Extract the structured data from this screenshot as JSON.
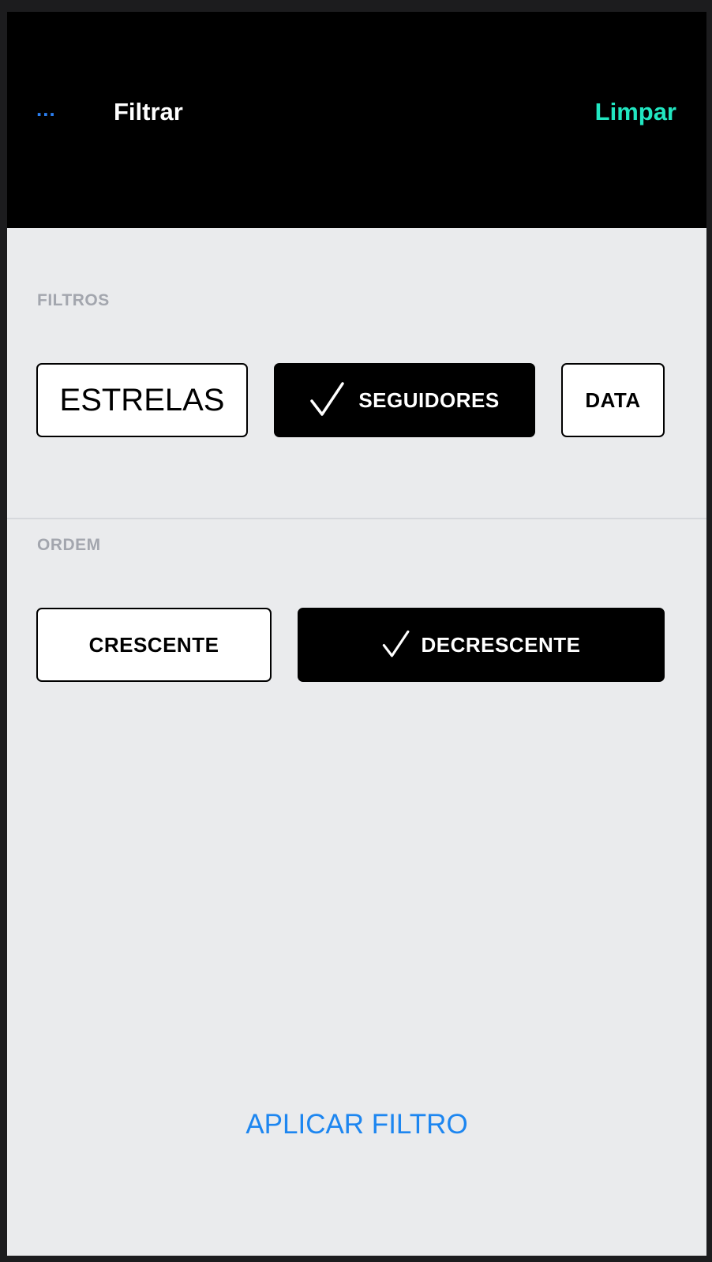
{
  "navbar": {
    "back_label": "...",
    "title": "Filtrar",
    "clear_label": "Limpar"
  },
  "filters": {
    "section_label": "FILTROS",
    "options": [
      {
        "label": "ESTRELAS",
        "selected": false
      },
      {
        "label": "SEGUIDORES",
        "selected": true
      },
      {
        "label": "DATA",
        "selected": false
      }
    ]
  },
  "order": {
    "section_label": "ORDEM",
    "options": [
      {
        "label": "CRESCENTE",
        "selected": false
      },
      {
        "label": "DECRESCENTE",
        "selected": true
      }
    ]
  },
  "apply_label": "APLICAR FILTRO",
  "colors": {
    "navbar_bg": "#000000",
    "back_link": "#2a7ef0",
    "clear_link": "#21e6c1",
    "apply_link": "#1d86f0",
    "page_bg": "#eaebed",
    "section_label": "#a3a6ae",
    "selected_chip_bg": "#000000",
    "unselected_chip_bg": "#ffffff"
  },
  "icons": {
    "selected_check": "checkmark-icon"
  }
}
